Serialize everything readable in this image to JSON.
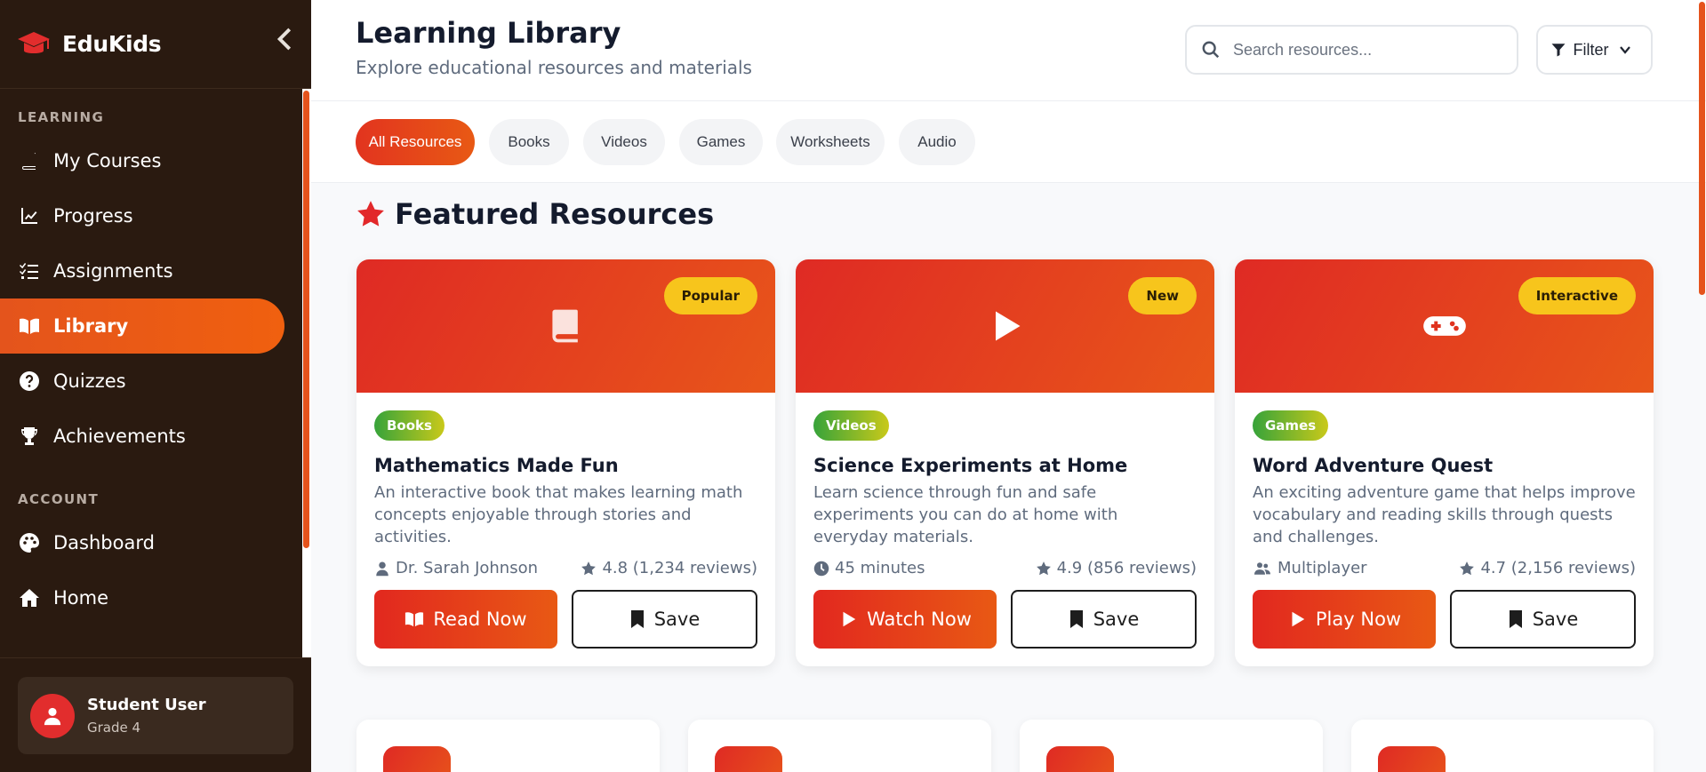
{
  "brand": {
    "name": "EduKids"
  },
  "sidebar": {
    "learning_label": "LEARNING",
    "learning_items": [
      {
        "label": "My Courses",
        "icon": "book-icon"
      },
      {
        "label": "Progress",
        "icon": "chart-line-icon"
      },
      {
        "label": "Assignments",
        "icon": "tasks-icon"
      },
      {
        "label": "Library",
        "icon": "book-open-icon",
        "active": true
      },
      {
        "label": "Quizzes",
        "icon": "question-circle-icon"
      },
      {
        "label": "Achievements",
        "icon": "trophy-icon"
      }
    ],
    "account_label": "ACCOUNT",
    "account_items": [
      {
        "label": "Dashboard",
        "icon": "palette-icon"
      },
      {
        "label": "Home",
        "icon": "home-icon"
      }
    ],
    "user": {
      "name": "Student User",
      "grade": "Grade 4"
    }
  },
  "header": {
    "title": "Learning Library",
    "subtitle": "Explore educational resources and materials",
    "search_placeholder": "Search resources...",
    "filter_label": "Filter"
  },
  "tabs": [
    "All Resources",
    "Books",
    "Videos",
    "Games",
    "Worksheets",
    "Audio"
  ],
  "featured": {
    "title": "Featured Resources",
    "cards": [
      {
        "badge": "Popular",
        "hero_icon": "book-icon",
        "category": "Books",
        "title": "Mathematics Made Fun",
        "description": "An interactive book that makes learning math concepts enjoyable through stories and activities.",
        "meta_left": "Dr. Sarah Johnson",
        "meta_left_icon": "user-icon",
        "rating": "4.8 (1,234 reviews)",
        "primary_action": "Read Now",
        "primary_icon": "book-open-icon",
        "secondary_action": "Save"
      },
      {
        "badge": "New",
        "hero_icon": "play-icon",
        "category": "Videos",
        "title": "Science Experiments at Home",
        "description": "Learn science through fun and safe experiments you can do at home with everyday materials.",
        "meta_left": "45 minutes",
        "meta_left_icon": "clock-icon",
        "rating": "4.9 (856 reviews)",
        "primary_action": "Watch Now",
        "primary_icon": "play-icon",
        "secondary_action": "Save"
      },
      {
        "badge": "Interactive",
        "hero_icon": "gamepad-icon",
        "category": "Games",
        "title": "Word Adventure Quest",
        "description": "An exciting adventure game that helps improve vocabulary and reading skills through quests and challenges.",
        "meta_left": "Multiplayer",
        "meta_left_icon": "users-icon",
        "rating": "4.7 (2,156 reviews)",
        "primary_action": "Play Now",
        "primary_icon": "play-icon",
        "secondary_action": "Save"
      }
    ]
  },
  "colors": {
    "accent": "#e5531c",
    "sidebar_bg": "#2a1a10",
    "badge": "#f7c51c"
  }
}
